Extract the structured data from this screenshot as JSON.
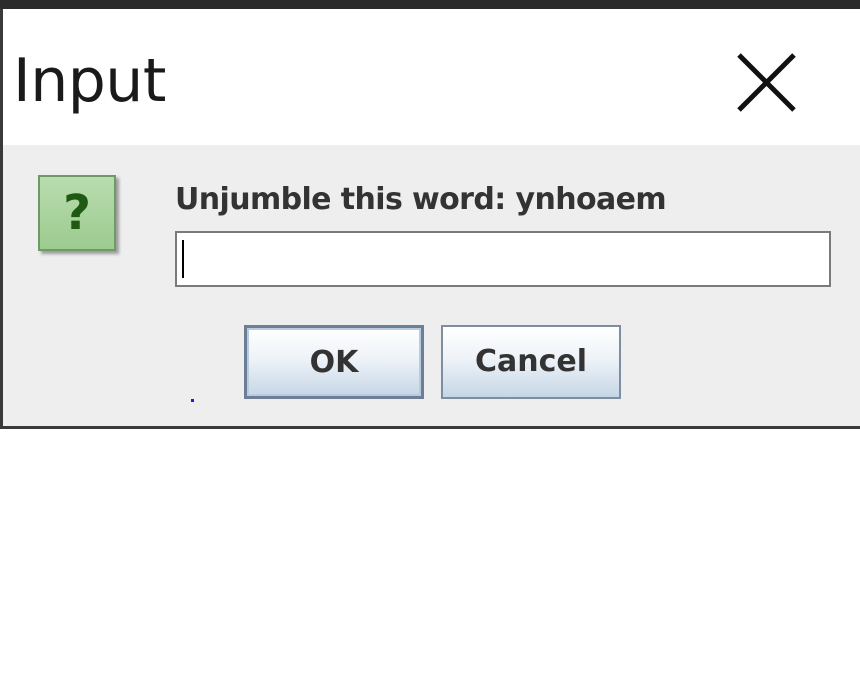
{
  "dialog": {
    "title": "Input",
    "close_icon": "close-x-icon",
    "message_icon": "question-icon",
    "message_icon_glyph": "?",
    "prompt": "Unjumble this word: ynhoaem",
    "input_value": "",
    "buttons": {
      "ok_label": "OK",
      "cancel_label": "Cancel"
    }
  },
  "colors": {
    "content_background": "#eeeeee",
    "titlebar_background": "#ffffff",
    "icon_green": "#9ccb8f",
    "icon_glyph": "#1e5a14"
  }
}
